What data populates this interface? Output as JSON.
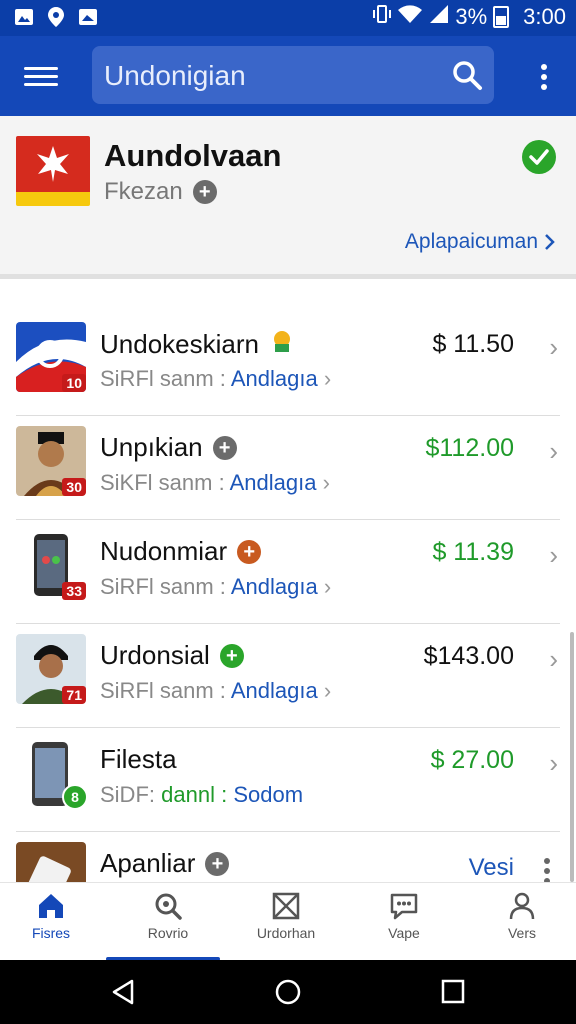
{
  "status_bar": {
    "battery_text": "3%",
    "time": "3:00"
  },
  "app_bar": {
    "search_text": "Undonigian"
  },
  "header": {
    "title": "Aundolvaan",
    "subtitle": "Fkezan",
    "link": "Aplapaicuman"
  },
  "items": [
    {
      "title": "Undokeskiarn",
      "sub_label": "SiRFl sanm :",
      "sub_value": "Andlagıa",
      "price": "$  11.50",
      "price_color": "#111111",
      "badge": "10"
    },
    {
      "title": "Unpıkian",
      "sub_label": "SiKFl sanm :",
      "sub_value": "Andlagıa",
      "price": "$112.00",
      "price_color": "#1f9a2a",
      "badge": "30"
    },
    {
      "title": "Nudonmiar",
      "sub_label": "SiRFl sanm :",
      "sub_value": "Andlagıa",
      "price": "$  11.39",
      "price_color": "#1f9a2a",
      "badge": "33"
    },
    {
      "title": "Urdonsial",
      "sub_label": "SiRFl sanm :",
      "sub_value": "Andlagıa",
      "price": "$143.00",
      "price_color": "#111111",
      "badge": "71"
    },
    {
      "title": "Filesta",
      "sub_label": "SiDF:",
      "sub_label_green": "dannl :",
      "sub_value": "Sodom",
      "price": "$  27.00",
      "price_color": "#1f9a2a",
      "badge": "8"
    },
    {
      "title": "Apanliar",
      "action": "Vesi"
    }
  ],
  "bottom_nav": [
    {
      "label": "Fisres",
      "icon": "home-icon",
      "active": true
    },
    {
      "label": "Rovrio",
      "icon": "search-icon"
    },
    {
      "label": "Urdorhan",
      "icon": "box-icon"
    },
    {
      "label": "Vape",
      "icon": "chat-icon"
    },
    {
      "label": "Vers",
      "icon": "person-icon"
    }
  ],
  "colors": {
    "primary": "#1448b8",
    "status_bar": "#0b3ea8",
    "accent_green": "#2aa52a",
    "link_blue": "#1d56b8"
  }
}
